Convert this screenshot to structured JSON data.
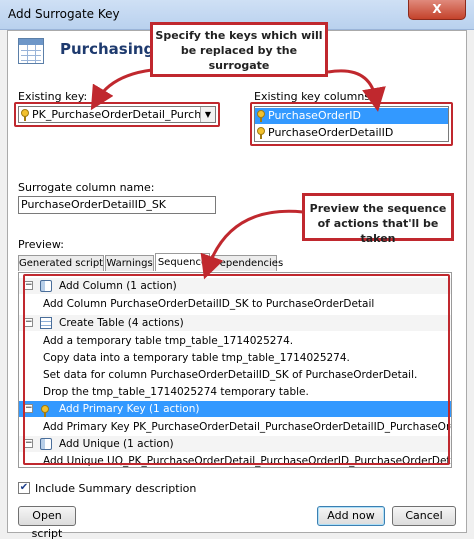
{
  "window": {
    "title": "Add Surrogate Key",
    "close_glyph": "X"
  },
  "heading": "Purchasing.PurchaseOrderDetail",
  "existing_key": {
    "label": "Existing key:",
    "value": "PK_PurchaseOrderDetail_PurchaseOrderID_PurchaseOrderDetailID"
  },
  "existing_key_columns": {
    "label": "Existing key columns:",
    "items": [
      "PurchaseOrderID",
      "PurchaseOrderDetailID"
    ]
  },
  "surrogate": {
    "label": "Surrogate column name:",
    "value": "PurchaseOrderDetailID_SK"
  },
  "preview": {
    "label": "Preview:",
    "tabs": [
      "Generated script",
      "Warnings",
      "Sequence",
      "Dependencies"
    ],
    "selected_tab": "Sequence",
    "groups": [
      {
        "title": "Add Column (1 action)",
        "icon": "column-icon",
        "items": [
          "Add Column PurchaseOrderDetailID_SK to PurchaseOrderDetail"
        ]
      },
      {
        "title": "Create Table (4 actions)",
        "icon": "table-icon",
        "items": [
          "Add a temporary table tmp_table_1714025274.",
          "Copy data into a temporary table tmp_table_1714025274.",
          "Set data for column PurchaseOrderDetailID_SK of PurchaseOrderDetail.",
          "Drop the tmp_table_1714025274 temporary table."
        ]
      },
      {
        "title": "Add Primary Key (1 action)",
        "icon": "key-icon",
        "selected": true,
        "items": [
          "Add Primary Key PK_PurchaseOrderDetail_PurchaseOrderDetailID_PurchaseOrderDetailID..."
        ]
      },
      {
        "title": "Add Unique (1 action)",
        "icon": "column-icon",
        "items": [
          "Add Unique UQ_PK_PurchaseOrderDetail_PurchaseOrderID_PurchaseOrderDetailID..."
        ]
      }
    ]
  },
  "summary": {
    "label": "Include Summary description",
    "checked": true
  },
  "buttons": {
    "open_script": "Open script",
    "add_now": "Add now",
    "cancel": "Cancel"
  },
  "callouts": {
    "keys": "Specify the keys which will be replaced by the surrogate",
    "sequence": "Preview the sequence of actions that'll be taken"
  },
  "colors": {
    "annotation_red": "#c0282e",
    "selection_blue": "#3399ff",
    "heading_blue": "#1e3a6e"
  }
}
